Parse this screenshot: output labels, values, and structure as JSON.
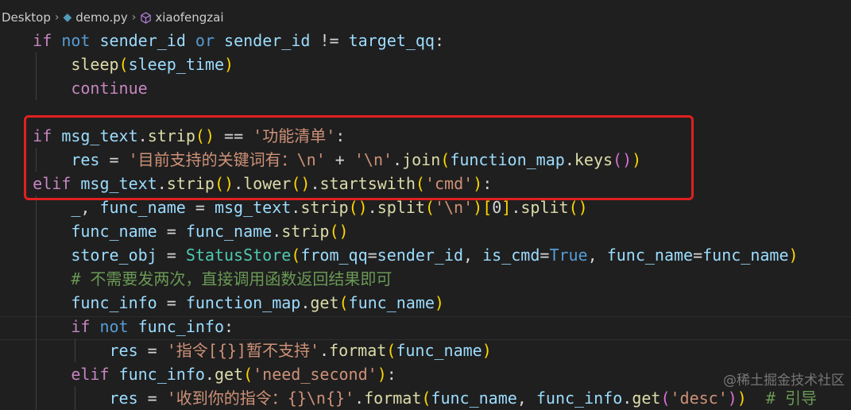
{
  "breadcrumb": {
    "folder": "Desktop",
    "file": "demo.py",
    "symbol": "xiaofengzai"
  },
  "code_lines": [
    [
      [
        "    "
      ],
      [
        "if",
        "ctl"
      ],
      [
        " "
      ],
      [
        "not",
        "kw"
      ],
      [
        " "
      ],
      [
        "sender_id",
        "var"
      ],
      [
        " "
      ],
      [
        "or",
        "kw"
      ],
      [
        " "
      ],
      [
        "sender_id",
        "var"
      ],
      [
        " != ",
        "op"
      ],
      [
        "target_qq",
        "var"
      ],
      [
        ":",
        "op"
      ]
    ],
    [
      [
        "        "
      ],
      [
        "sleep",
        "fn"
      ],
      [
        "(",
        "p1"
      ],
      [
        "sleep_time",
        "var"
      ],
      [
        ")",
        "p1"
      ]
    ],
    [
      [
        "        "
      ],
      [
        "continue",
        "ctl"
      ]
    ],
    [
      [
        ""
      ]
    ],
    [
      [
        "    "
      ],
      [
        "if",
        "ctl"
      ],
      [
        " "
      ],
      [
        "msg_text",
        "var"
      ],
      [
        ".",
        "op"
      ],
      [
        "strip",
        "fn"
      ],
      [
        "()",
        "p1"
      ],
      [
        " == ",
        "op"
      ],
      [
        "'功能清单'",
        "str"
      ],
      [
        ":",
        "op"
      ]
    ],
    [
      [
        "        "
      ],
      [
        "res",
        "var"
      ],
      [
        " = ",
        "op"
      ],
      [
        "'目前支持的关键词有：\\n'",
        "str"
      ],
      [
        " + ",
        "op"
      ],
      [
        "'\\n'",
        "str"
      ],
      [
        ".",
        "op"
      ],
      [
        "join",
        "fn"
      ],
      [
        "(",
        "p1"
      ],
      [
        "function_map",
        "var"
      ],
      [
        ".",
        "op"
      ],
      [
        "keys",
        "fn"
      ],
      [
        "()",
        "p2"
      ],
      [
        ")",
        "p1"
      ]
    ],
    [
      [
        "    "
      ],
      [
        "elif",
        "ctl"
      ],
      [
        " "
      ],
      [
        "msg_text",
        "var"
      ],
      [
        ".",
        "op"
      ],
      [
        "strip",
        "fn"
      ],
      [
        "()",
        "p1"
      ],
      [
        ".",
        "op"
      ],
      [
        "lower",
        "fn"
      ],
      [
        "()",
        "p1"
      ],
      [
        ".",
        "op"
      ],
      [
        "startswith",
        "fn"
      ],
      [
        "(",
        "p1"
      ],
      [
        "'cmd'",
        "str"
      ],
      [
        ")",
        "p1"
      ],
      [
        ":",
        "op"
      ]
    ],
    [
      [
        "        "
      ],
      [
        "_",
        "var"
      ],
      [
        ", ",
        "op"
      ],
      [
        "func_name",
        "var"
      ],
      [
        " = ",
        "op"
      ],
      [
        "msg_text",
        "var"
      ],
      [
        ".",
        "op"
      ],
      [
        "strip",
        "fn"
      ],
      [
        "()",
        "p1"
      ],
      [
        ".",
        "op"
      ],
      [
        "split",
        "fn"
      ],
      [
        "(",
        "p1"
      ],
      [
        "'\\n'",
        "str"
      ],
      [
        ")",
        "p1"
      ],
      [
        "[",
        "p1"
      ],
      [
        "0",
        "op"
      ],
      [
        "]",
        "p1"
      ],
      [
        ".",
        "op"
      ],
      [
        "split",
        "fn"
      ],
      [
        "()",
        "p1"
      ]
    ],
    [
      [
        "        "
      ],
      [
        "func_name",
        "var"
      ],
      [
        " = ",
        "op"
      ],
      [
        "func_name",
        "var"
      ],
      [
        ".",
        "op"
      ],
      [
        "strip",
        "fn"
      ],
      [
        "()",
        "p1"
      ]
    ],
    [
      [
        "        "
      ],
      [
        "store_obj",
        "var"
      ],
      [
        " = ",
        "op"
      ],
      [
        "StatusStore",
        "cls"
      ],
      [
        "(",
        "p1"
      ],
      [
        "from_qq",
        "var"
      ],
      [
        "=",
        "op"
      ],
      [
        "sender_id",
        "var"
      ],
      [
        ", ",
        "op"
      ],
      [
        "is_cmd",
        "var"
      ],
      [
        "=",
        "op"
      ],
      [
        "True",
        "kw"
      ],
      [
        ", ",
        "op"
      ],
      [
        "func_name",
        "var"
      ],
      [
        "=",
        "op"
      ],
      [
        "func_name",
        "var"
      ],
      [
        ")",
        "p1"
      ]
    ],
    [
      [
        "        "
      ],
      [
        "# 不需要发两次，直接调用函数返回结果即可",
        "cmt"
      ]
    ],
    [
      [
        "        "
      ],
      [
        "func_info",
        "var"
      ],
      [
        " = ",
        "op"
      ],
      [
        "function_map",
        "var"
      ],
      [
        ".",
        "op"
      ],
      [
        "get",
        "fn"
      ],
      [
        "(",
        "p1"
      ],
      [
        "func_name",
        "var"
      ],
      [
        ")",
        "p1"
      ]
    ],
    [
      [
        "        "
      ],
      [
        "if",
        "ctl"
      ],
      [
        " "
      ],
      [
        "not",
        "kw"
      ],
      [
        " "
      ],
      [
        "func_info",
        "var"
      ],
      [
        ":",
        "op"
      ]
    ],
    [
      [
        "            "
      ],
      [
        "res",
        "var"
      ],
      [
        " = ",
        "op"
      ],
      [
        "'指令[{}]暂不支持'",
        "str"
      ],
      [
        ".",
        "op"
      ],
      [
        "format",
        "fn"
      ],
      [
        "(",
        "p1"
      ],
      [
        "func_name",
        "var"
      ],
      [
        ")",
        "p1"
      ]
    ],
    [
      [
        "        "
      ],
      [
        "elif",
        "ctl"
      ],
      [
        " "
      ],
      [
        "func_info",
        "var"
      ],
      [
        ".",
        "op"
      ],
      [
        "get",
        "fn"
      ],
      [
        "(",
        "p1"
      ],
      [
        "'need_second'",
        "str"
      ],
      [
        ")",
        "p1"
      ],
      [
        ":",
        "op"
      ]
    ],
    [
      [
        "            "
      ],
      [
        "res",
        "var"
      ],
      [
        " = ",
        "op"
      ],
      [
        "'收到你的指令：{}\\n{}'",
        "str"
      ],
      [
        ".",
        "op"
      ],
      [
        "format",
        "fn"
      ],
      [
        "(",
        "p1"
      ],
      [
        "func_name",
        "var"
      ],
      [
        ", ",
        "op"
      ],
      [
        "func_info",
        "var"
      ],
      [
        ".",
        "op"
      ],
      [
        "get",
        "fn"
      ],
      [
        "(",
        "p2"
      ],
      [
        "'desc'",
        "str"
      ],
      [
        ")",
        "p2"
      ],
      [
        ")",
        "p1"
      ],
      [
        "  # 引导",
        "cmt"
      ]
    ]
  ],
  "watermark": "@稀土掘金技术社区",
  "colors": {
    "highlight_border": "#e02020",
    "background": "#1f1f1f"
  }
}
